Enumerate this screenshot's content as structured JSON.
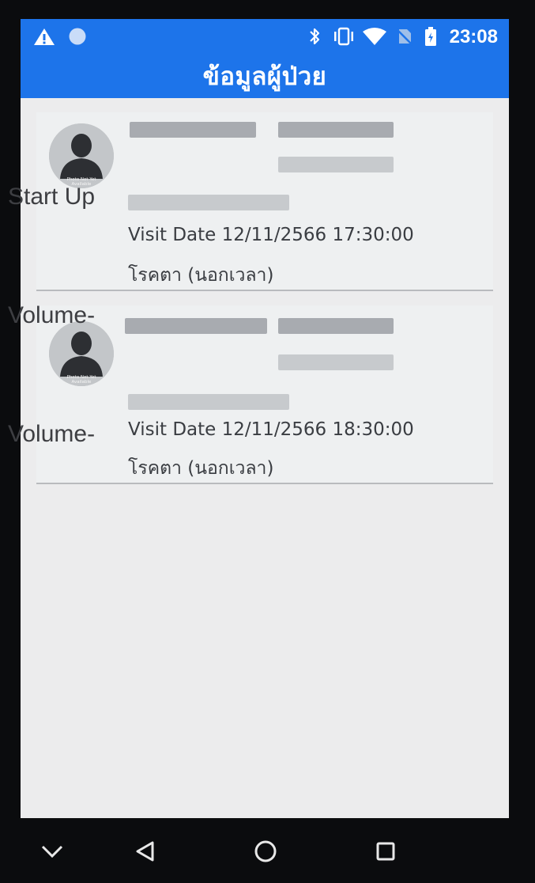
{
  "status_bar": {
    "time": "23:08",
    "icons": [
      "warning-icon",
      "circle-notification-icon",
      "bluetooth-icon",
      "vibrate-icon",
      "wifi-icon",
      "no-sim-icon",
      "battery-icon"
    ]
  },
  "app_bar": {
    "title": "ข้อมูลผู้ป่วย",
    "color": "#1d74ea"
  },
  "patients": [
    {
      "visit_date": "Visit Date 12/11/2566 17:30:00",
      "clinic": "โรคตา (นอกเวลา)",
      "avatar_caption": "Photo Not Yet Available"
    },
    {
      "visit_date": "Visit Date 12/11/2566 18:30:00",
      "clinic": "โรคตา (นอกเวลา)",
      "avatar_caption": "Photo Not Yet Available"
    }
  ],
  "overlay_labels": {
    "start_up": "Start Up",
    "volume_1": "Volume-",
    "volume_2": "Volume-"
  },
  "nav_bar": {
    "buttons": [
      "chevron-down-icon",
      "back-icon",
      "home-icon",
      "recents-icon"
    ]
  }
}
